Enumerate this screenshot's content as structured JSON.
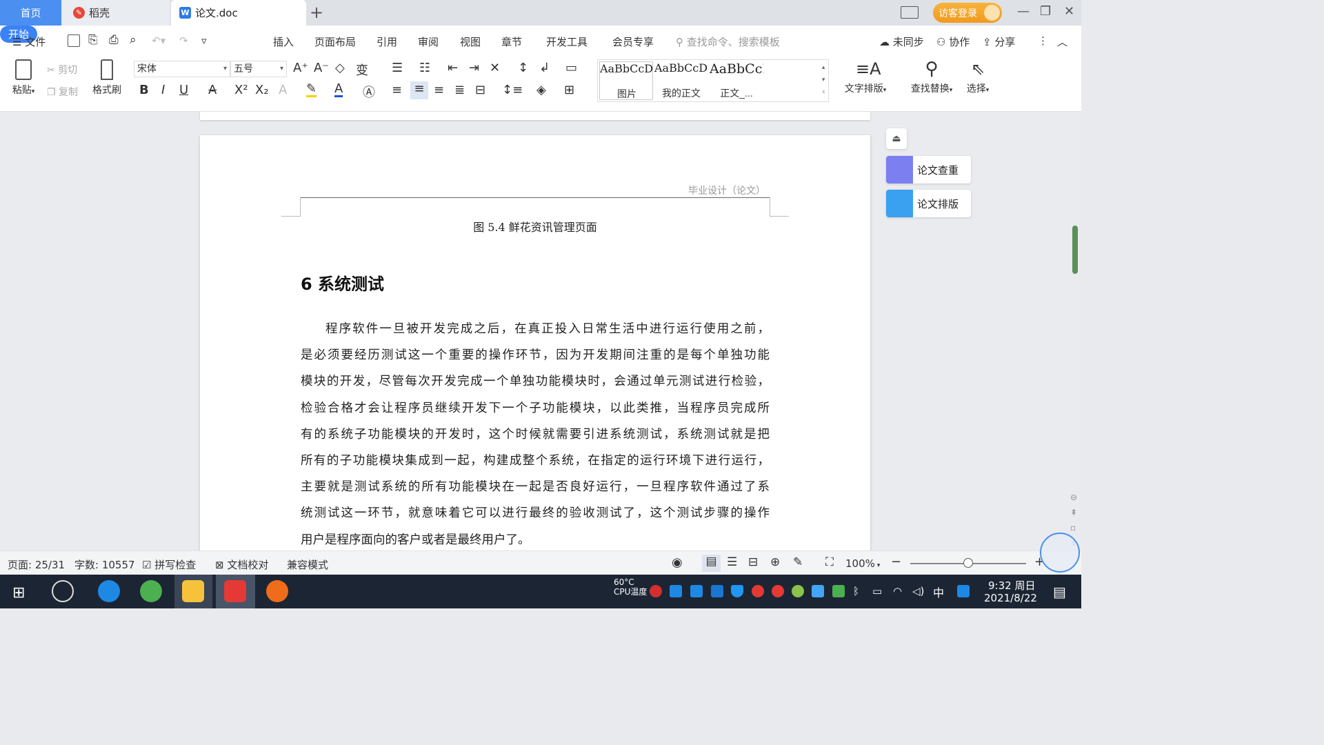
{
  "tabs": {
    "home": "首页",
    "daoke": "稻壳",
    "doc": "论文.doc",
    "add": "+"
  },
  "titlebar": {
    "visitor_login": "访客登录"
  },
  "menu": {
    "file": "文件",
    "start": "开始",
    "insert": "插入",
    "layout": "页面布局",
    "reference": "引用",
    "review": "审阅",
    "view": "视图",
    "chapter": "章节",
    "devtools": "开发工具",
    "member": "会员专享",
    "search_placeholder": "查找命令、搜索模板",
    "unsynced": "未同步",
    "collab": "协作",
    "share": "分享"
  },
  "ribbon": {
    "paste": "粘贴",
    "cut": "剪切",
    "copy": "复制",
    "format_painter": "格式刷",
    "font_name": "宋体",
    "font_size": "五号",
    "styles": [
      {
        "preview": "AaBbCcDd",
        "name": "图片"
      },
      {
        "preview": "AaBbCcDd",
        "name": "我的正文"
      },
      {
        "preview": "AaBbCcI",
        "name": "正文_..."
      }
    ],
    "text_layout": "文字排版",
    "find_replace": "查找替换",
    "select": "选择"
  },
  "document": {
    "header": "毕业设计（论文）",
    "figure_caption": "图 5.4  鲜花资讯管理页面",
    "section_title": "6  系统测试",
    "lines": [
      "程序软件一旦被开发完成之后，在真正投入日常生活中进行运行使用之前，",
      "是必须要经历测试这一个重要的操作环节，因为开发期间注重的是每个单独功能",
      "模块的开发，尽管每次开发完成一个单独功能模块时，会通过单元测试进行检验，",
      "检验合格才会让程序员继续开发下一个子功能模块，以此类推，当程序员完成所",
      "有的系统子功能模块的开发时，这个时候就需要引进系统测试，系统测试就是把",
      "所有的子功能模块集成到一起，构建成整个系统，在指定的运行环境下进行运行，",
      "主要就是测试系统的所有功能模块在一起是否良好运行，一旦程序软件通过了系",
      "统测试这一环节，就意味着它可以进行最终的验收测试了，这个测试步骤的操作",
      "用户是程序面向的客户或者是最终用户了。"
    ]
  },
  "side_panel": {
    "check": "论文查重",
    "format": "论文排版"
  },
  "status": {
    "page": "页面: 25/31",
    "words": "字数: 10557",
    "spell": "拼写检查",
    "proofread": "文档校对",
    "compat": "兼容模式",
    "zoom": "100%",
    "zoom_level": 0.5
  },
  "taskbar": {
    "cpu_temp": "60°C",
    "cpu_label": "CPU温度",
    "ime": "中",
    "time": "9:32 周日",
    "date": "2021/8/22"
  },
  "colors": {
    "accent": "#3b82f6",
    "tab_home": "#4b8ff1",
    "visitor": "#f5a623",
    "taskbar": "#1c2533"
  }
}
